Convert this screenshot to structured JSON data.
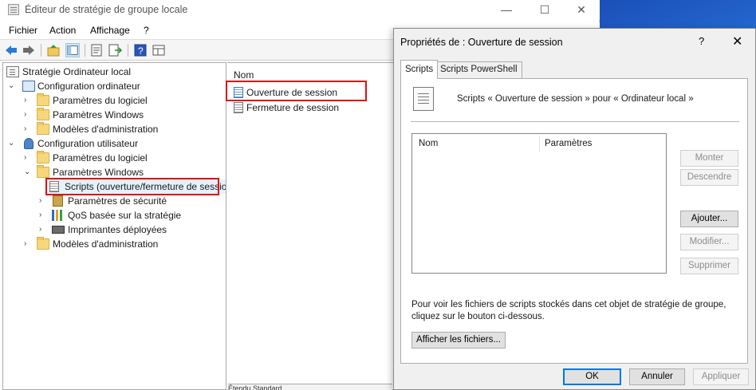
{
  "window": {
    "title": "Éditeur de stratégie de groupe locale",
    "minimize": "—",
    "maximize": "☐",
    "close": "✕"
  },
  "menu": [
    "Fichier",
    "Action",
    "Affichage",
    "?"
  ],
  "tree": {
    "root": "Stratégie Ordinateur local",
    "computer_config": "Configuration ordinateur",
    "computer_children": [
      "Paramètres du logiciel",
      "Paramètres Windows",
      "Modèles d'administration"
    ],
    "user_config": "Configuration utilisateur",
    "user_software": "Paramètres du logiciel",
    "user_windows": "Paramètres Windows",
    "scripts": "Scripts (ouverture/fermeture de session)",
    "security": "Paramètres de sécurité",
    "qos": "QoS basée sur la stratégie",
    "printers": "Imprimantes déployées",
    "user_admin": "Modèles d'administration"
  },
  "list": {
    "header": "Nom",
    "items": [
      "Ouverture de session",
      "Fermeture de session"
    ]
  },
  "bottom_tabs": "Étendu  Standard",
  "dialog": {
    "title": "Propriétés de : Ouverture de session",
    "help": "?",
    "close": "✕",
    "tabs": [
      "Scripts",
      "Scripts PowerShell"
    ],
    "description": "Scripts « Ouverture de session » pour « Ordinateur local »",
    "columns": [
      "Nom",
      "Paramètres"
    ],
    "side_buttons": [
      "Monter",
      "Descendre",
      "Ajouter...",
      "Modifier...",
      "Supprimer"
    ],
    "info": "Pour voir les fichiers de scripts stockés dans cet objet de stratégie de groupe, cliquez sur le bouton ci-dessous.",
    "show_files": "Afficher les fichiers...",
    "ok": "OK",
    "cancel": "Annuler",
    "apply": "Appliquer"
  }
}
